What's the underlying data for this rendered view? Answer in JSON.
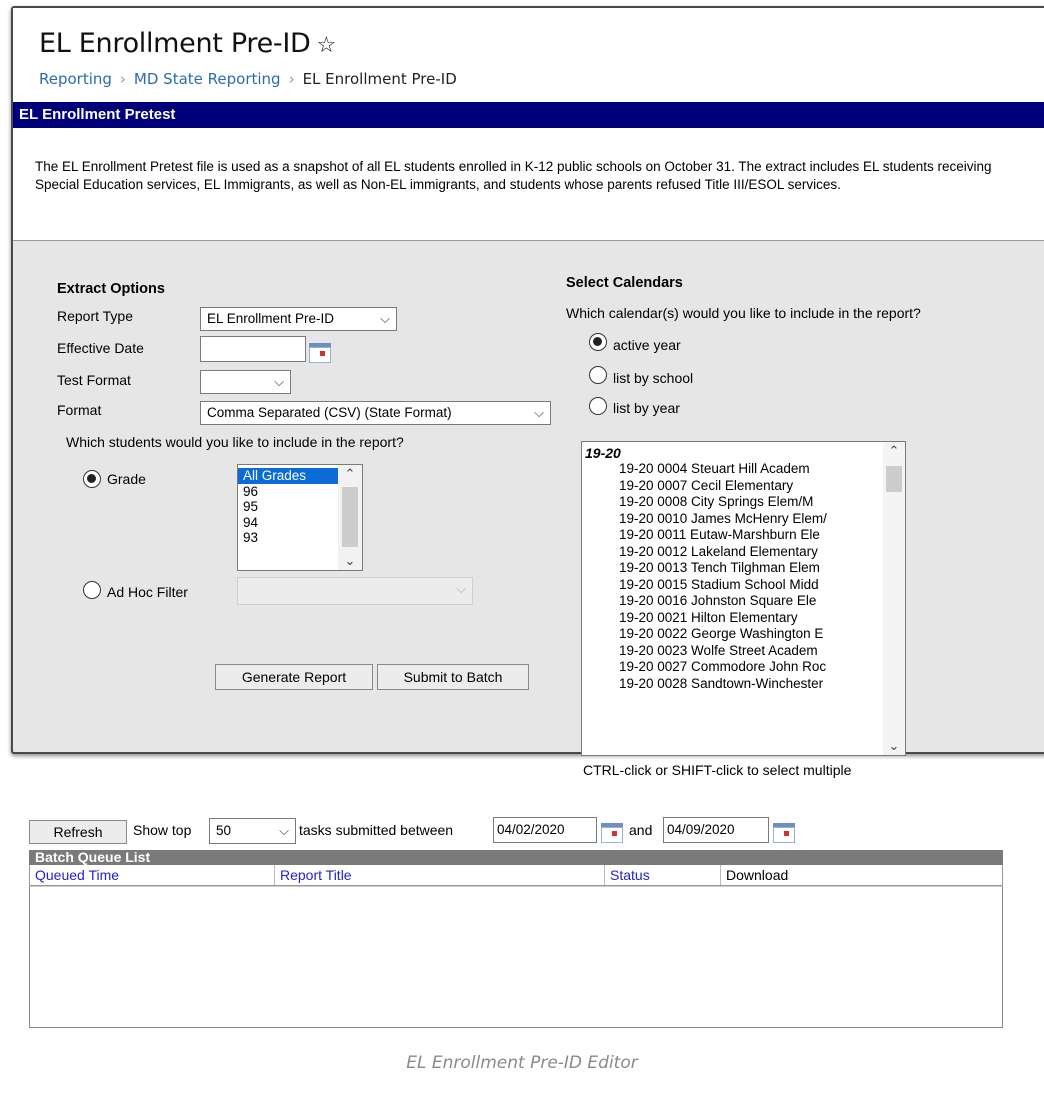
{
  "page": {
    "title": "EL Enrollment Pre-ID",
    "star": "☆",
    "breadcrumb": [
      "Reporting",
      "MD State Reporting",
      "EL Enrollment Pre-ID"
    ],
    "breadcrumb_sep": "›"
  },
  "banner": {
    "title": "EL Enrollment Pretest"
  },
  "description": "The EL Enrollment Pretest file is used as a snapshot of all EL students enrolled in K-12 public schools on October 31. The extract includes EL students receiving Special Education services, EL Immigrants, as well as Non-EL immigrants, and students whose parents refused Title III/ESOL services.",
  "extract": {
    "heading": "Extract Options",
    "report_type_label": "Report Type",
    "report_type_value": "EL Enrollment Pre-ID",
    "effective_date_label": "Effective Date",
    "effective_date_value": "",
    "test_format_label": "Test Format",
    "test_format_value": "",
    "format_label": "Format",
    "format_value": "Comma Separated (CSV) (State Format)",
    "students_question": "Which students would you like to include in the report?",
    "grade_label": "Grade",
    "grade_selected": true,
    "grades": [
      "All Grades",
      "96",
      "95",
      "94",
      "93"
    ],
    "adhoc_label": "Ad Hoc Filter",
    "adhoc_selected": false,
    "adhoc_value": "",
    "generate_label": "Generate Report",
    "batch_label": "Submit to Batch"
  },
  "calendars": {
    "heading": "Select Calendars",
    "question": "Which calendar(s) would you like to include in the report?",
    "options": [
      {
        "label": "active year",
        "selected": true
      },
      {
        "label": "list by school",
        "selected": false
      },
      {
        "label": "list by year",
        "selected": false
      }
    ],
    "group": "19-20",
    "items": [
      "19-20 0004 Steuart Hill Academ",
      "19-20 0007 Cecil Elementary",
      "19-20 0008 City Springs Elem/M",
      "19-20 0010 James McHenry Elem/",
      "19-20 0011 Eutaw-Marshburn Ele",
      "19-20 0012 Lakeland Elementary",
      "19-20 0013 Tench Tilghman Elem",
      "19-20 0015 Stadium School Midd",
      "19-20 0016 Johnston Square Ele",
      "19-20 0021 Hilton Elementary",
      "19-20 0022 George Washington E",
      "19-20 0023 Wolfe Street Academ",
      "19-20 0027 Commodore John Roc",
      "19-20 0028 Sandtown-Winchester"
    ],
    "hint": "CTRL-click or SHIFT-click to select multiple"
  },
  "batch": {
    "refresh_label": "Refresh",
    "show_top_label": "Show top",
    "top_value": "50",
    "between_label": "tasks submitted between",
    "from_date": "04/02/2020",
    "and_label": "and",
    "to_date": "04/09/2020",
    "list_title": "Batch Queue List",
    "columns": [
      "Queued Time",
      "Report Title",
      "Status",
      "Download"
    ]
  },
  "caption": "EL Enrollment Pre-ID Editor",
  "colors": {
    "banner": "#00007a",
    "link": "#2b6cb0",
    "selection": "#0b6cd6",
    "column_link": "#2222cc"
  }
}
